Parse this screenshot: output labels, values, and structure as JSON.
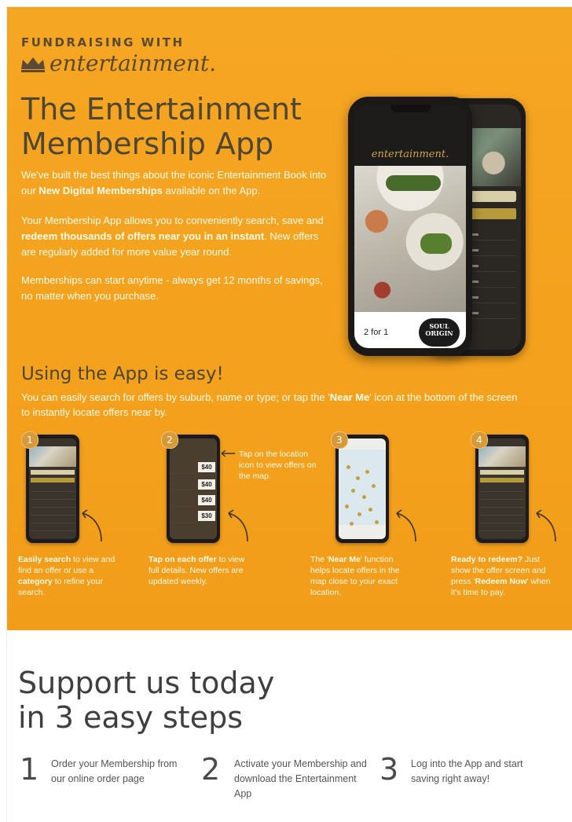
{
  "brand": {
    "top": "FUNDRAISING WITH",
    "logo_word": "entertainment."
  },
  "hero": {
    "title_line1": "The Entertainment",
    "title_line2": "Membership App",
    "p1_a": "We've built the best things about the iconic Entertainment Book into our ",
    "p1_b": "New Digital Memberships",
    "p1_c": " available on the App.",
    "p2_a": "Your Membership App allows you to conveniently search, save and ",
    "p2_b": "redeem thousands of offers near you in an instant",
    "p2_c": ". New offers are regularly added for more value year round.",
    "p3": "Memberships can start anytime - always get 12 months of savings, no matter when you purchase.",
    "phone_logo": "entertainment.",
    "phone_offer": "2 for 1",
    "phone_badge_l1": "SOUL",
    "phone_badge_l2": "ORIGIN"
  },
  "using": {
    "title": "Using the App is easy!",
    "text_a": "You can easily search for offers by suburb, name or type; or tap the '",
    "text_b": "Near Me",
    "text_c": "' icon at the bottom of the screen to instantly locate offers near by.",
    "side_note": "Tap on the location icon to view offers on the map.",
    "steps": [
      {
        "num": "1",
        "bold1": "Easily search",
        "t1": " to view and find an offer or use a ",
        "bold2": "category",
        "t2": " to refine your search."
      },
      {
        "num": "2",
        "bold1": "Tap on each offer",
        "t1": " to view full details. New offers are updated weekly.",
        "bold2": "",
        "t2": ""
      },
      {
        "num": "3",
        "bold1": "",
        "t1": "The '",
        "bold2": "Near Me",
        "t2": "' function helps locate offers in the map close to your exact location."
      },
      {
        "num": "4",
        "bold1": "Ready to redeem?",
        "t1": " Just show the offer screen and press '",
        "bold2": "Redeem Now",
        "t2": "' when it's time to pay."
      }
    ],
    "prices": [
      "$40",
      "$40",
      "$40",
      "$30"
    ]
  },
  "support": {
    "title_line1": "Support us today",
    "title_line2": "in 3 easy steps",
    "steps": [
      {
        "num": "1",
        "text": "Order your Membership from our online order page"
      },
      {
        "num": "2",
        "text": "Activate your Membership and download the Entertainment App"
      },
      {
        "num": "3",
        "text": "Log into the App and start saving right away!"
      }
    ]
  },
  "colors": {
    "orange": "#f5a623",
    "brown": "#4e4634",
    "cream": "#fffbe9"
  }
}
